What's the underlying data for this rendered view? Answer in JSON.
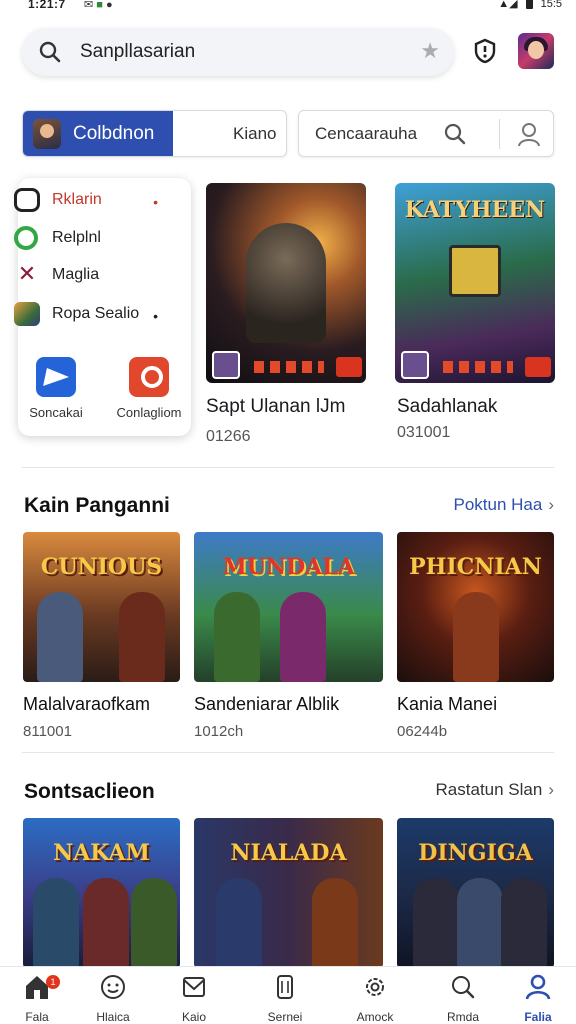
{
  "status_bar": {
    "time": "1:21:7",
    "right_text": "15:5"
  },
  "search": {
    "text": "Sanpllasarian"
  },
  "segment": {
    "active_label": "Colbdnon",
    "other_label": "Kiano"
  },
  "filter": {
    "label": "Cencaarauha"
  },
  "quick_menu": {
    "items": [
      {
        "label": "Rklarin",
        "dot": "•"
      },
      {
        "label": "Relplnl",
        "dot": ""
      },
      {
        "label": "Maglia",
        "dot": ""
      },
      {
        "label": "Ropa Sealio",
        "dot": "•"
      }
    ],
    "actions": [
      {
        "label": "Soncakai"
      },
      {
        "label": "Conlagliom"
      }
    ]
  },
  "featured": [
    {
      "art_title": "",
      "title": "Sapt Ulanan lJm",
      "sub": "01266"
    },
    {
      "art_title": "KATYHEEN",
      "title": "Sadahlanak",
      "sub": "031001"
    }
  ],
  "sections": [
    {
      "title": "Kain Panganni",
      "link": "Poktun Haa",
      "games": [
        {
          "art_title": "CUNIOUS",
          "name": "Malalvaraofkam",
          "sub": "811001"
        },
        {
          "art_title": "MUNDALA",
          "name": "Sandeniarar Alblik",
          "sub": "1012ch"
        },
        {
          "art_title": "PHICNIAN",
          "name": "Kania Manei",
          "sub": "06244b"
        }
      ]
    },
    {
      "title": "Sontsaclieon",
      "link": "Rastatun Slan",
      "games": [
        {
          "art_title": "NAKAM",
          "name": "",
          "sub": ""
        },
        {
          "art_title": "NIALADA",
          "name": "",
          "sub": ""
        },
        {
          "art_title": "DINGIGA",
          "name": "",
          "sub": ""
        }
      ]
    }
  ],
  "bottom_nav": [
    {
      "label": "Fala",
      "icon": "home-icon",
      "badge": "1"
    },
    {
      "label": "Hlaica",
      "icon": "smiley-icon",
      "badge": ""
    },
    {
      "label": "Kaio",
      "icon": "mail-icon",
      "badge": ""
    },
    {
      "label": "Sernei",
      "icon": "phone-icon",
      "badge": ""
    },
    {
      "label": "Amock",
      "icon": "gear-icon",
      "badge": ""
    },
    {
      "label": "Rmda",
      "icon": "search-icon",
      "badge": ""
    },
    {
      "label": "Falia",
      "icon": "profile-icon",
      "badge": ""
    }
  ],
  "colors": {
    "accent": "#2f4fb0",
    "notification": "#e0341f"
  }
}
